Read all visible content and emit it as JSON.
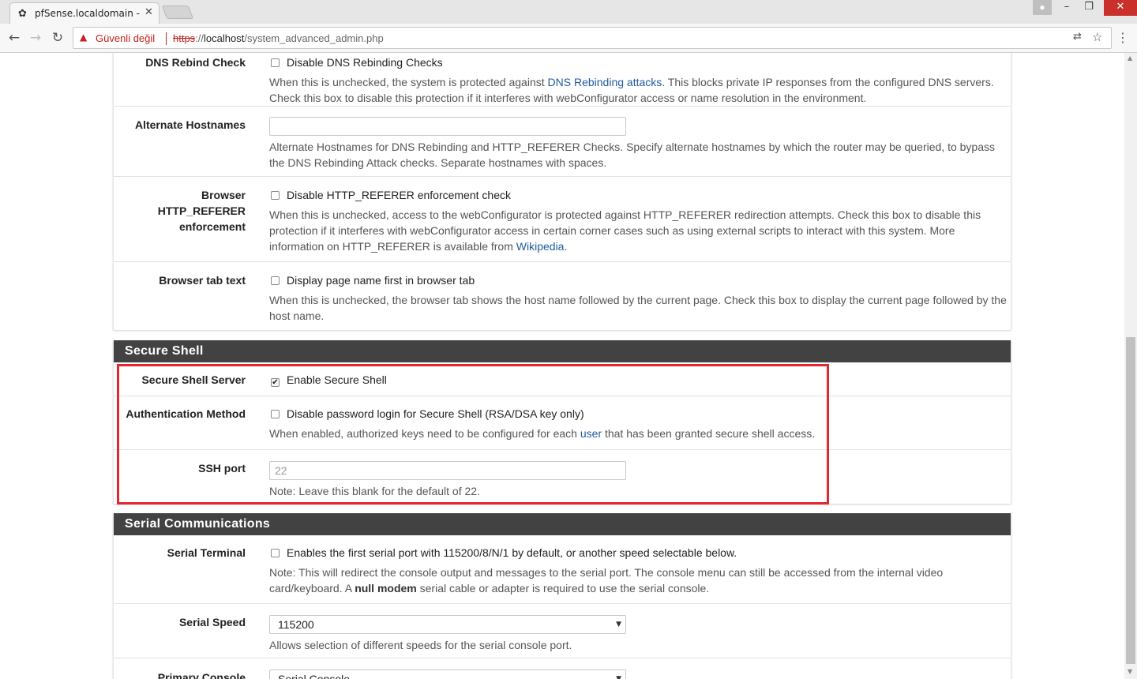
{
  "browser": {
    "tab_title": "pfSense.localdomain - Sy",
    "security_label": "Güvenli değil",
    "url_scheme": "https",
    "url_sep": "://",
    "url_host": "localhost",
    "url_path": "/system_advanced_admin.php"
  },
  "sections": {
    "webconfig": {
      "dns_rebind": {
        "label": "DNS Rebind Check",
        "checkbox_label": "Disable DNS Rebinding Checks",
        "checked": false,
        "help_before": "When this is unchecked, the system is protected against ",
        "help_link": "DNS Rebinding attacks",
        "help_after": ". This blocks private IP responses from the configured DNS servers. Check this box to disable this protection if it interferes with webConfigurator access or name resolution in the environment."
      },
      "alt_hostnames": {
        "label": "Alternate Hostnames",
        "value": "",
        "help": "Alternate Hostnames for DNS Rebinding and HTTP_REFERER Checks. Specify alternate hostnames by which the router may be queried, to bypass the DNS Rebinding Attack checks. Separate hostnames with spaces."
      },
      "http_referer": {
        "label_line1": "Browser HTTP_REFERER",
        "label_line2": "enforcement",
        "checkbox_label": "Disable HTTP_REFERER enforcement check",
        "checked": false,
        "help_before": "When this is unchecked, access to the webConfigurator is protected against HTTP_REFERER redirection attempts. Check this box to disable this protection if it interferes with webConfigurator access in certain corner cases such as using external scripts to interact with this system. More information on HTTP_REFERER is available from ",
        "help_link": "Wikipedia",
        "help_after": "."
      },
      "tab_text": {
        "label": "Browser tab text",
        "checkbox_label": "Display page name first in browser tab",
        "checked": false,
        "help": "When this is unchecked, the browser tab shows the host name followed by the current page. Check this box to display the current page followed by the host name."
      }
    },
    "ssh": {
      "title": "Secure Shell",
      "server": {
        "label": "Secure Shell Server",
        "checkbox_label": "Enable Secure Shell",
        "checked": true
      },
      "auth": {
        "label": "Authentication Method",
        "checkbox_label": "Disable password login for Secure Shell (RSA/DSA key only)",
        "checked": false,
        "help_before": "When enabled, authorized keys need to be configured for each ",
        "help_link": "user",
        "help_after": " that has been granted secure shell access."
      },
      "port": {
        "label": "SSH port",
        "placeholder": "22",
        "help": "Note: Leave this blank for the default of 22."
      }
    },
    "serial": {
      "title": "Serial Communications",
      "terminal": {
        "label": "Serial Terminal",
        "checkbox_label": "Enables the first serial port with 115200/8/N/1 by default, or another speed selectable below.",
        "checked": false,
        "help_before": "Note: This will redirect the console output and messages to the serial port. The console menu can still be accessed from the internal video card/keyboard. A ",
        "help_bold": "null modem",
        "help_after": " serial cable or adapter is required to use the serial console."
      },
      "speed": {
        "label": "Serial Speed",
        "value": "115200",
        "help": "Allows selection of different speeds for the serial console port."
      },
      "console": {
        "label": "Primary Console",
        "value": "Serial Console"
      }
    }
  },
  "icons": {
    "favicon": "pfsense-logo-icon",
    "warning": "warning-triangle-icon",
    "translate": "translate-icon",
    "bookmark": "star-icon",
    "menu": "kebab-menu-icon"
  },
  "colors": {
    "section_header_bg": "#424242",
    "link": "#1f5a9e",
    "highlight_border": "#e3262f",
    "insecure_red": "#c5221f"
  }
}
